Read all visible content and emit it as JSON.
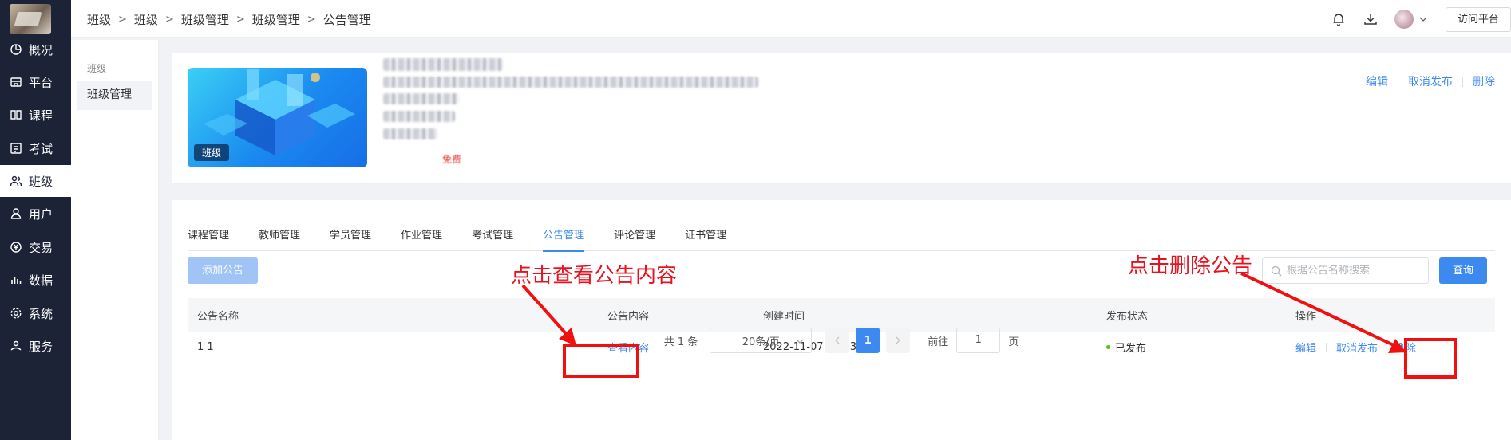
{
  "sidebar": {
    "items": [
      {
        "label": "概况",
        "icon": "pie-chart-icon"
      },
      {
        "label": "平台",
        "icon": "store-icon"
      },
      {
        "label": "课程",
        "icon": "book-icon"
      },
      {
        "label": "考试",
        "icon": "exam-icon"
      },
      {
        "label": "班级",
        "icon": "class-users-icon",
        "active": true
      },
      {
        "label": "用户",
        "icon": "user-icon"
      },
      {
        "label": "交易",
        "icon": "trade-icon"
      },
      {
        "label": "数据",
        "icon": "bar-chart-icon"
      },
      {
        "label": "系统",
        "icon": "settings-icon"
      },
      {
        "label": "服务",
        "icon": "service-icon"
      }
    ]
  },
  "submenu": {
    "title": "班级",
    "active_item": "班级管理"
  },
  "breadcrumb": [
    "班级",
    "班级",
    "班级管理",
    "班级管理",
    "公告管理"
  ],
  "topbar": {
    "icons": [
      "bell-icon",
      "download-icon"
    ],
    "visit_label": "访问平台"
  },
  "course_card": {
    "cover_tag": "班级",
    "free_label": "免费",
    "actions": [
      "编辑",
      "取消发布",
      "删除"
    ]
  },
  "tabs": [
    {
      "label": "课程管理"
    },
    {
      "label": "教师管理"
    },
    {
      "label": "学员管理"
    },
    {
      "label": "作业管理"
    },
    {
      "label": "考试管理"
    },
    {
      "label": "公告管理",
      "active": true
    },
    {
      "label": "评论管理"
    },
    {
      "label": "证书管理"
    }
  ],
  "toolbar": {
    "add_label": "添加公告",
    "search_placeholder": "根据公告名称搜索",
    "query_label": "查询"
  },
  "table": {
    "headers": [
      "公告名称",
      "公告内容",
      "创建时间",
      "发布状态",
      "操作"
    ],
    "rows": [
      {
        "name": "1 1",
        "content_link": "查看内容",
        "created": "2022-11-07 15:33:57",
        "status": "已发布",
        "ops": [
          "编辑",
          "取消发布",
          "删除"
        ]
      }
    ]
  },
  "pagination": {
    "total": "共 1 条",
    "page_size": "20条/页",
    "current_page": "1",
    "goto_label": "前往",
    "goto_value": "1",
    "page_suffix": "页"
  },
  "annotations": {
    "view_content": "点击查看公告内容",
    "delete": "点击删除公告",
    "color": "#e8121f"
  },
  "colors": {
    "primary": "#3c8af0",
    "sidebar_bg": "#1c2337",
    "status_dot": "#52c41a"
  }
}
